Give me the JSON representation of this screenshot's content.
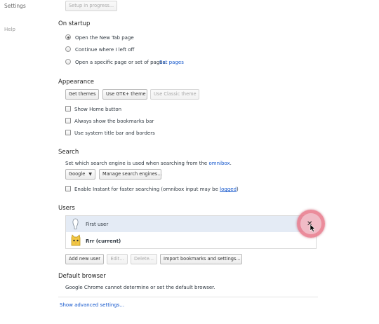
{
  "nav": {
    "title": "Settings",
    "help": "Help",
    "setup_button": "Setup in progress..."
  },
  "startup": {
    "heading": "On startup",
    "options": [
      {
        "label": "Open the New Tab page",
        "selected": true
      },
      {
        "label": "Continue where I left off",
        "selected": false
      },
      {
        "label": "Open a specific page or set of pages.",
        "selected": false
      }
    ],
    "set_pages_link": "Set pages"
  },
  "appearance": {
    "heading": "Appearance",
    "buttons": {
      "get_themes": "Get themes",
      "gtk_theme": "Use GTK+ theme",
      "classic_theme": "Use Classic theme"
    },
    "checkboxes": [
      {
        "label": "Show Home button",
        "checked": false
      },
      {
        "label": "Always show the bookmarks bar",
        "checked": false
      },
      {
        "label": "Use system title bar and borders",
        "checked": false
      }
    ]
  },
  "search": {
    "heading": "Search",
    "description": "Set which search engine is used when searching from the",
    "omnibox_link": "omnibox",
    "description_end": ".",
    "engine_selected": "Google",
    "manage_button": "Manage search engines...",
    "instant_label": "Enable Instant for faster searching (omnibox input may be",
    "instant_link": "logged",
    "instant_end": ")",
    "instant_checked": false
  },
  "users": {
    "heading": "Users",
    "list": [
      {
        "name": "First user",
        "selected": true
      },
      {
        "name": "Rrr (current)",
        "selected": false
      }
    ],
    "buttons": {
      "add": "Add new user",
      "edit": "Edit...",
      "delete": "Delete...",
      "import": "Import bookmarks and settings..."
    }
  },
  "default_browser": {
    "heading": "Default browser",
    "message": "Google Chrome cannot determine or set the default browser."
  },
  "advanced_link": "Show advanced settings...",
  "colors": {
    "link": "#1155cc",
    "selected_row": "#e4ebf5",
    "click_highlight": "#e8788a"
  }
}
